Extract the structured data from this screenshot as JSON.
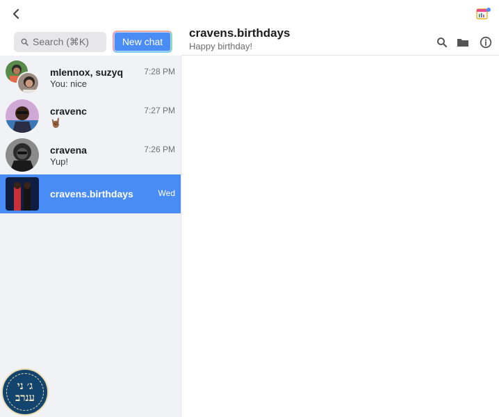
{
  "sidebar": {
    "search_placeholder": "Search (⌘K)",
    "new_chat_label": "New chat"
  },
  "chats": [
    {
      "name": "mlennox, suzyq",
      "preview": "You: nice",
      "time": "7:28 PM",
      "avatar": "group-avatar"
    },
    {
      "name": "cravenc",
      "preview": "🤘🏾",
      "time": "7:27 PM",
      "avatar": "avatar"
    },
    {
      "name": "cravena",
      "preview": "Yup!",
      "time": "7:26 PM",
      "avatar": "avatar"
    },
    {
      "name": "cravens.birthdays",
      "preview": "",
      "time": "Wed",
      "avatar": "avatar",
      "active": true
    }
  ],
  "conversation": {
    "title": "cravens.birthdays",
    "subtitle": "Happy birthday!"
  },
  "header_icons": [
    "search-icon",
    "folder-icon",
    "info-icon"
  ],
  "badge": {
    "line1": "ג׳ ני",
    "line2": "ענרב"
  },
  "colors": {
    "accent": "#4a8cf5",
    "sidebar_bg": "#f1f2f6",
    "badge_bg": "#13446e"
  }
}
